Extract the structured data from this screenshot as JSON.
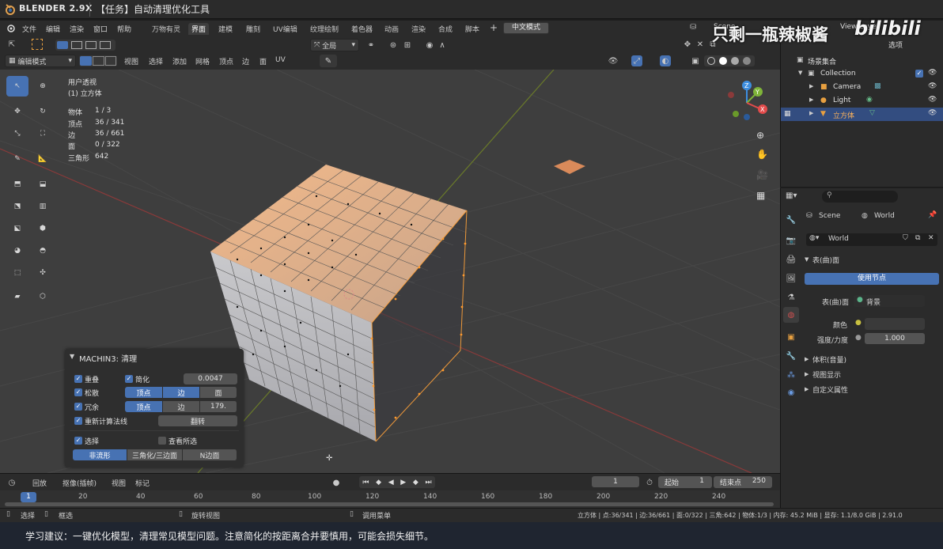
{
  "titlebar": {
    "app_name": "BLENDER 2.9X",
    "task": "【任务】自动清理优化工具"
  },
  "watermark": {
    "text": "只剩一瓶辣椒酱",
    "brand": "bilibili"
  },
  "menu": {
    "items": [
      "文件",
      "编辑",
      "渲染",
      "窗口",
      "帮助"
    ]
  },
  "workspaces": {
    "tabs": [
      "万物有灵",
      "界面",
      "建模",
      "雕刻",
      "UV编辑",
      "纹理绘制",
      "着色器",
      "动画",
      "渲染",
      "合成",
      "脚本"
    ],
    "active": "界面",
    "lang_button": "中文模式"
  },
  "top_right": {
    "scene": "Scene",
    "view_layer": "View Layer",
    "options": "选项"
  },
  "viewport_header": {
    "mode": "编辑模式",
    "menus": [
      "视图",
      "选择",
      "添加",
      "网格",
      "顶点",
      "边",
      "面",
      "UV"
    ],
    "transform_orientation": "全局"
  },
  "viewport": {
    "view_name": "用户透视",
    "object_name": "(1) 立方体",
    "stats": [
      {
        "label": "物体",
        "value": "1 / 3"
      },
      {
        "label": "顶点",
        "value": "36 / 341"
      },
      {
        "label": "边",
        "value": "36 / 661"
      },
      {
        "label": "面",
        "value": "0 / 322"
      },
      {
        "label": "三角形",
        "value": "642"
      }
    ],
    "gizmo_axes": [
      "Z",
      "Y",
      "X"
    ]
  },
  "operator_panel": {
    "title": "MACHIN3: 清理",
    "rows": {
      "merge": {
        "label": "重叠",
        "checked": true
      },
      "simplify": {
        "label": "简化",
        "checked": true,
        "value": "0.0047"
      },
      "loose": {
        "label": "松散",
        "checked": true,
        "options": [
          "顶点",
          "边",
          "面"
        ],
        "selected": [
          "边"
        ]
      },
      "redundant": {
        "label": "冗余",
        "checked": true,
        "options": [
          "顶点",
          "边"
        ],
        "selected": [
          "顶点"
        ],
        "angle": "179."
      },
      "recalc": {
        "label": "重新计算法线",
        "checked": true,
        "button": "翻转"
      },
      "select": {
        "label": "选择",
        "checked": true,
        "view_selected": "查看所选",
        "view_selected_checked": false
      },
      "select_modes": {
        "options": [
          "非流形",
          "三角化/三边面",
          "N边面"
        ],
        "selected": "非流形"
      }
    }
  },
  "timeline": {
    "menus": [
      "回放",
      "抠像(插帧)",
      "视图",
      "标记"
    ],
    "current_frame": "1",
    "start_label": "起始",
    "start": "1",
    "end_label": "结束点",
    "end": "250",
    "ruler": [
      "1",
      "20",
      "40",
      "60",
      "80",
      "100",
      "120",
      "140",
      "160",
      "180",
      "200",
      "220",
      "240"
    ]
  },
  "statusbar": {
    "left": [
      "选择",
      "框选",
      "旋转视图",
      "调用菜单"
    ],
    "right": "立方体 | 点:36/341 | 边:36/661 | 面:0/322 | 三角:642 | 物体:1/3 | 内存: 45.2 MiB | 显存: 1.1/8.0 GiB | 2.91.0"
  },
  "caption": {
    "text": "学习建议：一键优化模型，清理常见模型问题。注意简化的按距离合并要慎用，可能会损失细节。"
  },
  "outliner": {
    "root": "场景集合",
    "items": [
      {
        "name": "Collection",
        "level": 1
      },
      {
        "name": "Camera",
        "level": 2
      },
      {
        "name": "Light",
        "level": 2
      },
      {
        "name": "立方体",
        "level": 2,
        "selected": true
      }
    ]
  },
  "properties": {
    "breadcrumb": [
      "Scene",
      "World"
    ],
    "world_name": "World",
    "section_surface": "表(曲)面",
    "use_nodes": "使用节点",
    "surface_label": "表(曲)面",
    "surface_value": "背景",
    "color_label": "颜色",
    "strength_label": "强度/力度",
    "strength_value": "1.000",
    "collapsed_sections": [
      "体积(音量)",
      "视图显示",
      "自定义属性"
    ]
  },
  "colors": {
    "accent": "#4772b3",
    "selected_row": "#334d80",
    "x_axis": "#e34b4b",
    "y_axis": "#7fb439",
    "z_axis": "#3d8ee0",
    "vertex_selected": "#ff9a2e"
  }
}
